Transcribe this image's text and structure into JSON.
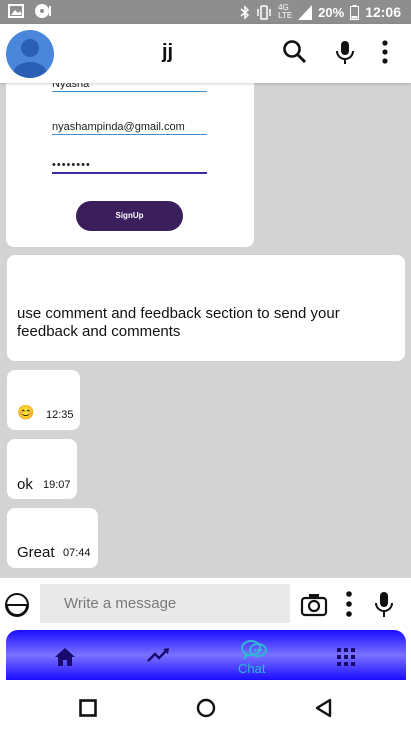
{
  "status_bar": {
    "network": "4G",
    "network_alt": "LTE",
    "battery_percent": "20%",
    "time": "12:06"
  },
  "header": {
    "title": "jj",
    "icons": [
      "avatar-icon",
      "search-icon",
      "mic-icon",
      "more-vert-icon"
    ]
  },
  "chat": {
    "image_message": {
      "name_value": "Nyasha",
      "email_value": "nyashampinda@gmail.com",
      "password_value": "••••••••",
      "button_label": "SignUp"
    },
    "text_message": "use comment and feedback section to send your feedback and comments",
    "messages": [
      {
        "text": "😊",
        "time": "12:35"
      },
      {
        "text": "ok",
        "time": "19:07"
      },
      {
        "text": "Great",
        "time": "07:44"
      }
    ]
  },
  "composer": {
    "placeholder": "Write a message",
    "icons": [
      "emoji-icon",
      "camera-icon",
      "more-vert-icon",
      "mic-icon"
    ]
  },
  "bottom_nav": {
    "items": [
      {
        "icon": "home-icon",
        "label": ""
      },
      {
        "icon": "trending-icon",
        "label": ""
      },
      {
        "icon": "chat-icon",
        "label": "Chat"
      },
      {
        "icon": "apps-grid-icon",
        "label": ""
      }
    ],
    "gradient_colors": [
      "#1b0cff",
      "#7a73ff"
    ],
    "active_color": "#2fb6d6"
  },
  "system_nav": [
    "recents-icon",
    "home-circle-icon",
    "back-icon"
  ]
}
